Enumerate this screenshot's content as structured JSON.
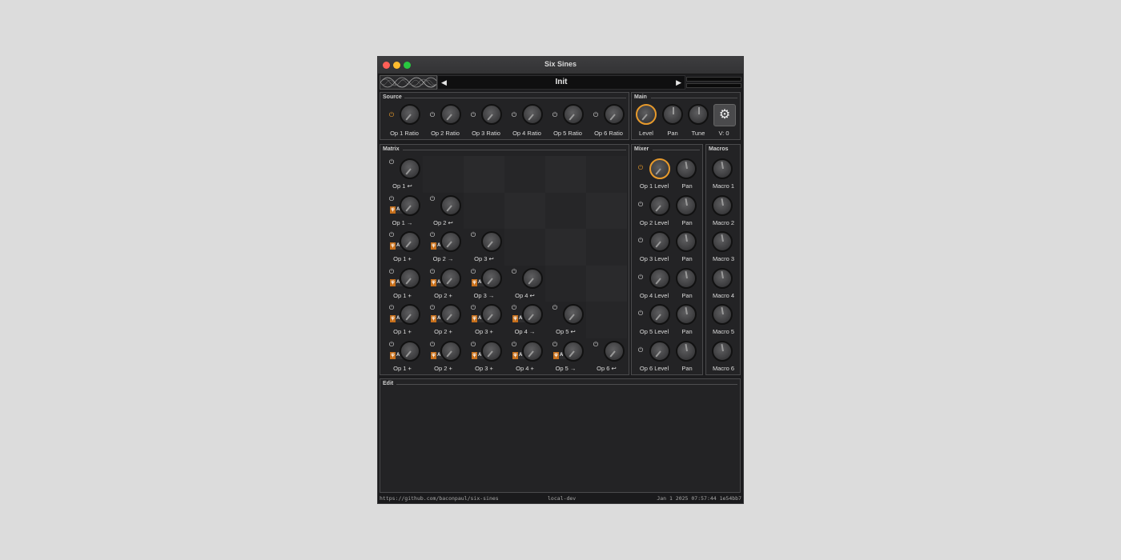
{
  "window": {
    "title": "Six Sines"
  },
  "preset": {
    "name": "Init",
    "prev": "◀",
    "next": "▶"
  },
  "source": {
    "title": "Source",
    "ops": [
      "Op 1 Ratio",
      "Op 2 Ratio",
      "Op 3 Ratio",
      "Op 4 Ratio",
      "Op 5 Ratio",
      "Op 6 Ratio"
    ]
  },
  "main": {
    "title": "Main",
    "level": "Level",
    "pan": "Pan",
    "tune": "Tune",
    "voices": "V: 0"
  },
  "matrix": {
    "title": "Matrix",
    "phase_label": "A",
    "phase_symbol": "φ",
    "rows": [
      [
        "Op 1 ↩"
      ],
      [
        "Op 1 →",
        "Op 2 ↩"
      ],
      [
        "Op 1 +",
        "Op 2 →",
        "Op 3 ↩"
      ],
      [
        "Op 1 +",
        "Op 2 +",
        "Op 3 →",
        "Op 4 ↩"
      ],
      [
        "Op 1 +",
        "Op 2 +",
        "Op 3 +",
        "Op 4 →",
        "Op 5 ↩"
      ],
      [
        "Op 1 +",
        "Op 2 +",
        "Op 3 +",
        "Op 4 +",
        "Op 5 →",
        "Op 6 ↩"
      ]
    ]
  },
  "mixer": {
    "title": "Mixer",
    "levels": [
      "Op 1 Level",
      "Op 2 Level",
      "Op 3 Level",
      "Op 4 Level",
      "Op 5 Level",
      "Op 6 Level"
    ],
    "pan": "Pan"
  },
  "macros": {
    "title": "Macros",
    "items": [
      "Macro 1",
      "Macro 2",
      "Macro 3",
      "Macro 4",
      "Macro 5",
      "Macro 6"
    ]
  },
  "edit": {
    "title": "Edit"
  },
  "status": {
    "url": "https://github.com/baconpaul/six-sines",
    "build": "local-dev",
    "date": "Jan  1 2025 07:57:44 1e54bb7"
  },
  "colors": {
    "accent": "#e79a2c",
    "panel": "#232325",
    "background": "#1c1c1e"
  },
  "icons": {
    "power": "power-icon",
    "settings": "gear-icon",
    "logo": "sine-waves-logo"
  }
}
